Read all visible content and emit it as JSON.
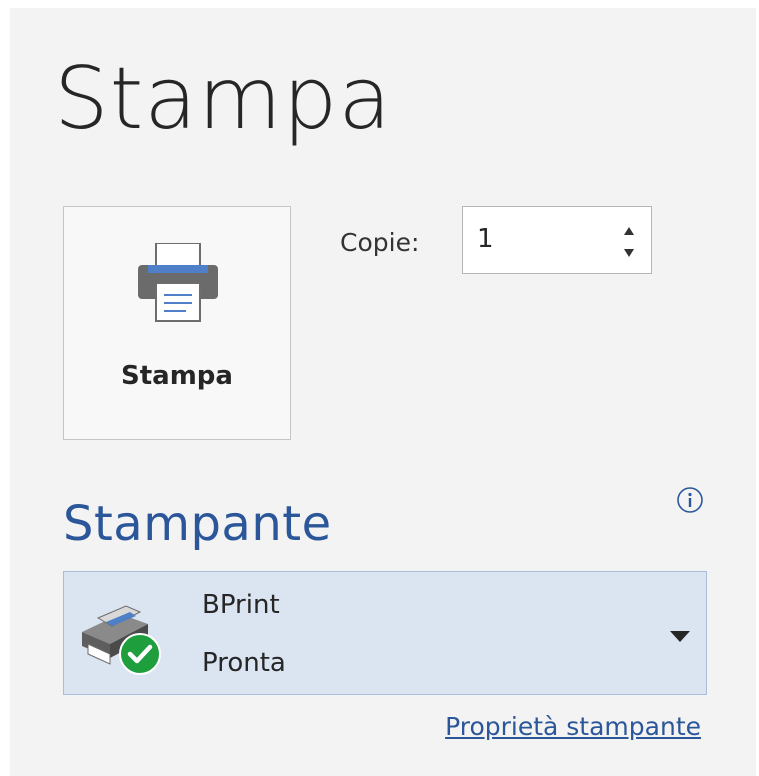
{
  "page": {
    "title": "Stampa"
  },
  "print_button": {
    "label": "Stampa",
    "icon": "printer-icon"
  },
  "copies": {
    "label": "Copie:",
    "value": "1"
  },
  "printer_section": {
    "title": "Stampante",
    "info_icon": "info-icon",
    "selected_printer": {
      "name": "BPrint",
      "status": "Pronta",
      "icon": "printer-ready-icon",
      "status_color": "#1f9e3d"
    },
    "properties_link": "Proprietà stampante"
  },
  "colors": {
    "accent": "#2b579a",
    "dropdown_bg": "#dbe4f1",
    "background": "#f3f3f3"
  }
}
